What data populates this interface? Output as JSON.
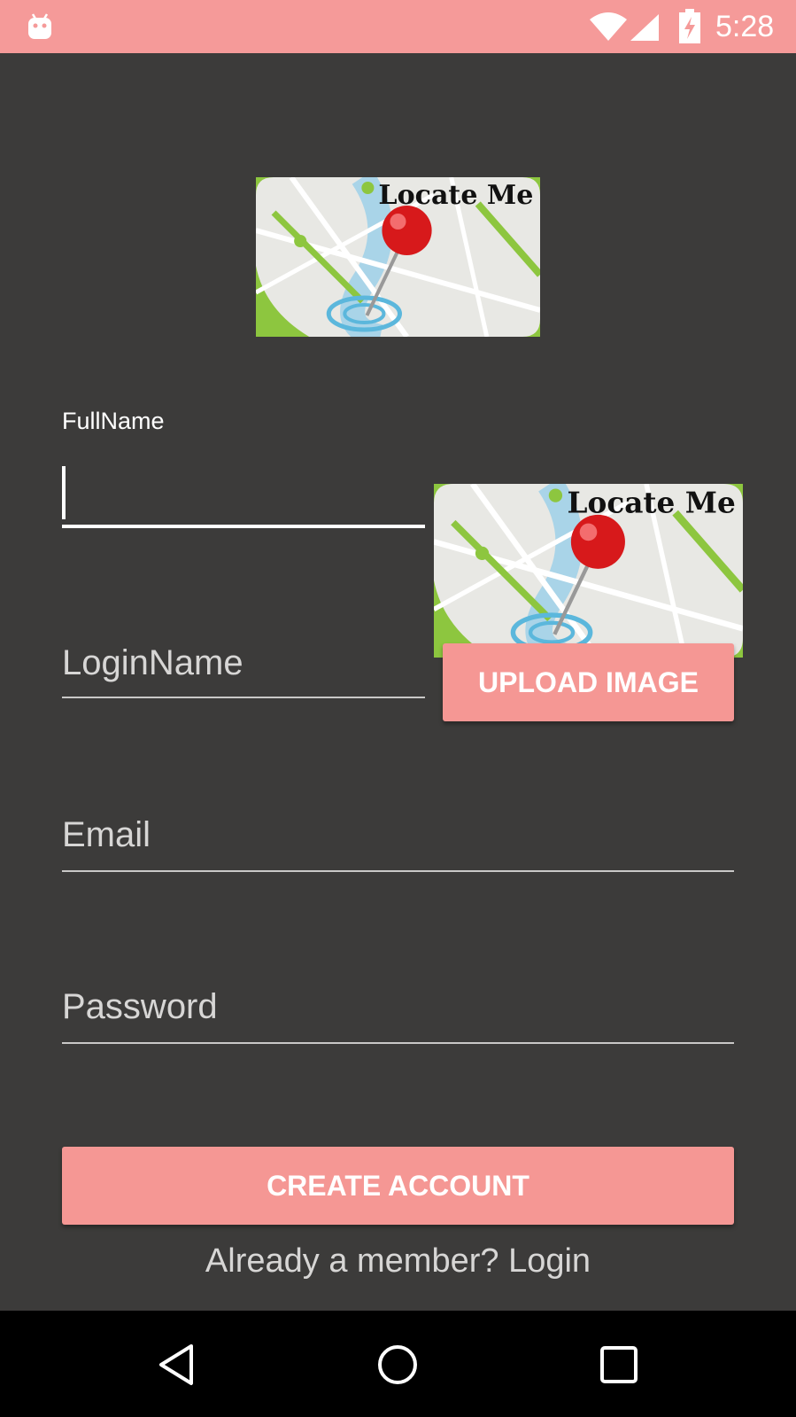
{
  "status_bar": {
    "time": "5:28",
    "color": "#f59a99",
    "icons": [
      "android-icon",
      "wifi-icon",
      "cell-signal-icon",
      "battery-charging-icon"
    ]
  },
  "logo": {
    "text": "Locate Me",
    "icon": "map-pin-icon"
  },
  "form": {
    "fullname_label": "FullName",
    "fullname_value": "",
    "loginname_placeholder": "LoginName",
    "email_placeholder": "Email",
    "password_placeholder": "Password"
  },
  "profile_image": {
    "text": "Locate Me"
  },
  "buttons": {
    "upload_label": "UPLOAD IMAGE",
    "create_label": "CREATE ACCOUNT",
    "accent": "#f59794"
  },
  "footer": {
    "login_link": "Already a member? Login"
  },
  "nav_bar": {
    "icons": [
      "back-icon",
      "home-icon",
      "recents-icon"
    ]
  }
}
